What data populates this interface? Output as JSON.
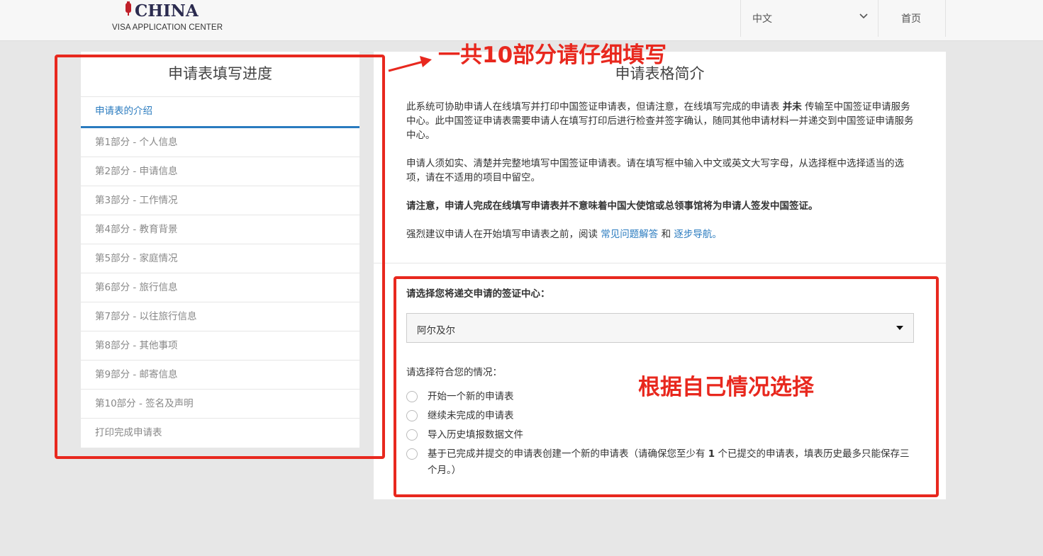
{
  "header": {
    "logo_title": "CHINA",
    "logo_subtitle": "VISA APPLICATION CENTER",
    "language": "中文",
    "home": "首页"
  },
  "progress": {
    "title": "申请表填写进度",
    "items": [
      {
        "label": "申请表的介绍"
      },
      {
        "label": "第1部分 - 个人信息"
      },
      {
        "label": "第2部分 - 申请信息"
      },
      {
        "label": "第3部分 - 工作情况"
      },
      {
        "label": "第4部分 - 教育背景"
      },
      {
        "label": "第5部分 - 家庭情况"
      },
      {
        "label": "第6部分 - 旅行信息"
      },
      {
        "label": "第7部分 - 以往旅行信息"
      },
      {
        "label": "第8部分 - 其他事项"
      },
      {
        "label": "第9部分 - 邮寄信息"
      },
      {
        "label": "第10部分 - 签名及声明"
      },
      {
        "label": "打印完成申请表"
      }
    ]
  },
  "intro": {
    "title": "申请表格简介",
    "p1_a": "此系统可协助申请人在线填写并打印中国签证申请表，但请注意，在线填写完成的申请表",
    "p1_bold": "并未",
    "p1_b": "传输至中国签证申请服务中心。此中国签证申请表需要申请人在填写打印后进行检查并签字确认，随同其他申请材料一并递交到中国签证申请服务中心。",
    "p2": "申请人须如实、清楚并完整地填写中国签证申请表。请在填写框中输入中文或英文大写字母，从选择框中选择适当的选项，请在不适用的项目中留空。",
    "p3": "请注意，申请人完成在线填写申请表并不意味着中国大使馆或总领事馆将为申请人签发中国签证。",
    "p4_a": "强烈建议申请人在开始填写申请表之前，阅读",
    "p4_link1": "常见问题解答",
    "p4_mid": "和",
    "p4_link2": "逐步导航。"
  },
  "form": {
    "center_label": "请选择您将递交申请的签证中心：",
    "center_value": "阿尔及尔",
    "situation_label": "请选择符合您的情况：",
    "options": [
      {
        "label": "开始一个新的申请表"
      },
      {
        "label": "继续未完成的申请表"
      },
      {
        "label": "导入历史填报数据文件"
      },
      {
        "label_a": "基于已完成并提交的申请表创建一个新的申请表（请确保您至少有 ",
        "label_bold": "1",
        "label_b": " 个已提交的申请表，填表历史最多只能保存三个月。）"
      }
    ]
  },
  "annotations": {
    "top_note": "一共10部分请仔细填写",
    "right_note": "根据自己情况选择",
    "color": "#e8281e"
  }
}
